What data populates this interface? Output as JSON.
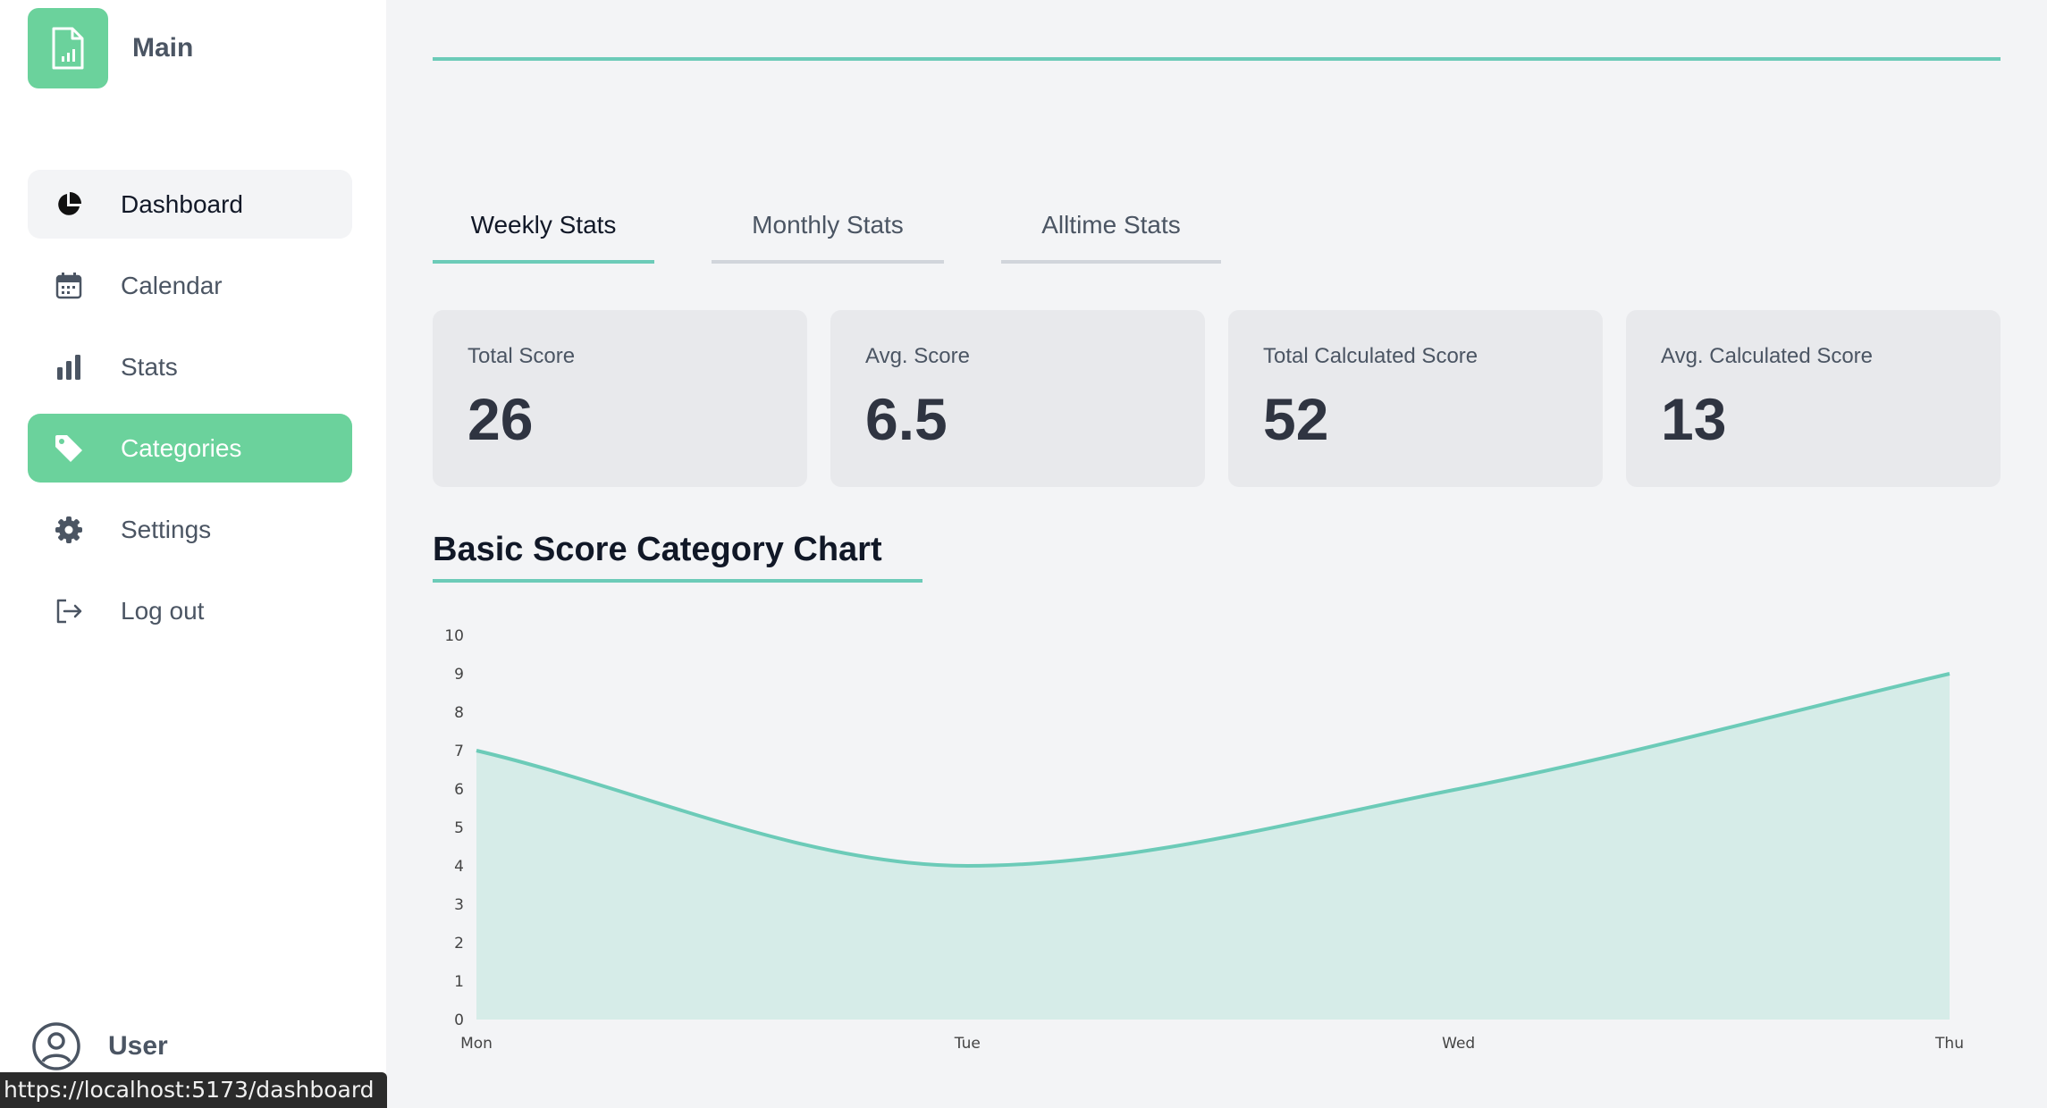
{
  "brand": {
    "name": "Main",
    "icon": "document-chart-icon",
    "color": "#6bd29c"
  },
  "sidebar": {
    "items": [
      {
        "label": "Dashboard",
        "icon": "pie-chart-icon"
      },
      {
        "label": "Calendar",
        "icon": "calendar-icon"
      },
      {
        "label": "Stats",
        "icon": "bar-chart-icon"
      },
      {
        "label": "Categories",
        "icon": "tag-icon"
      },
      {
        "label": "Settings",
        "icon": "gear-icon"
      },
      {
        "label": "Log out",
        "icon": "logout-icon"
      }
    ],
    "user": {
      "label": "User",
      "icon": "user-circle-icon"
    }
  },
  "status_bar": {
    "url": "https://localhost:5173/dashboard"
  },
  "tabs": [
    {
      "label": "Weekly Stats",
      "active": true
    },
    {
      "label": "Monthly Stats",
      "active": false
    },
    {
      "label": "Alltime Stats",
      "active": false
    }
  ],
  "cards": [
    {
      "label": "Total Score",
      "value": "26"
    },
    {
      "label": "Avg. Score",
      "value": "6.5"
    },
    {
      "label": "Total Calculated Score",
      "value": "52"
    },
    {
      "label": "Avg. Calculated Score",
      "value": "13"
    }
  ],
  "chart": {
    "title": "Basic Score Category Chart"
  },
  "colors": {
    "accent": "#6ccbb8",
    "fill": "#d6ece8",
    "active_nav": "#6bd29c"
  },
  "chart_data": {
    "type": "area",
    "title": "Basic Score Category Chart",
    "categories": [
      "Mon",
      "Tue",
      "Wed",
      "Thu"
    ],
    "values": [
      7,
      4,
      6,
      9
    ],
    "ylim": [
      0,
      10
    ],
    "yticks": [
      "0",
      "1",
      "2",
      "3",
      "4",
      "5",
      "6",
      "7",
      "8",
      "9",
      "10"
    ],
    "xlabel": "",
    "ylabel": "",
    "grid": false,
    "curve": "smooth"
  }
}
